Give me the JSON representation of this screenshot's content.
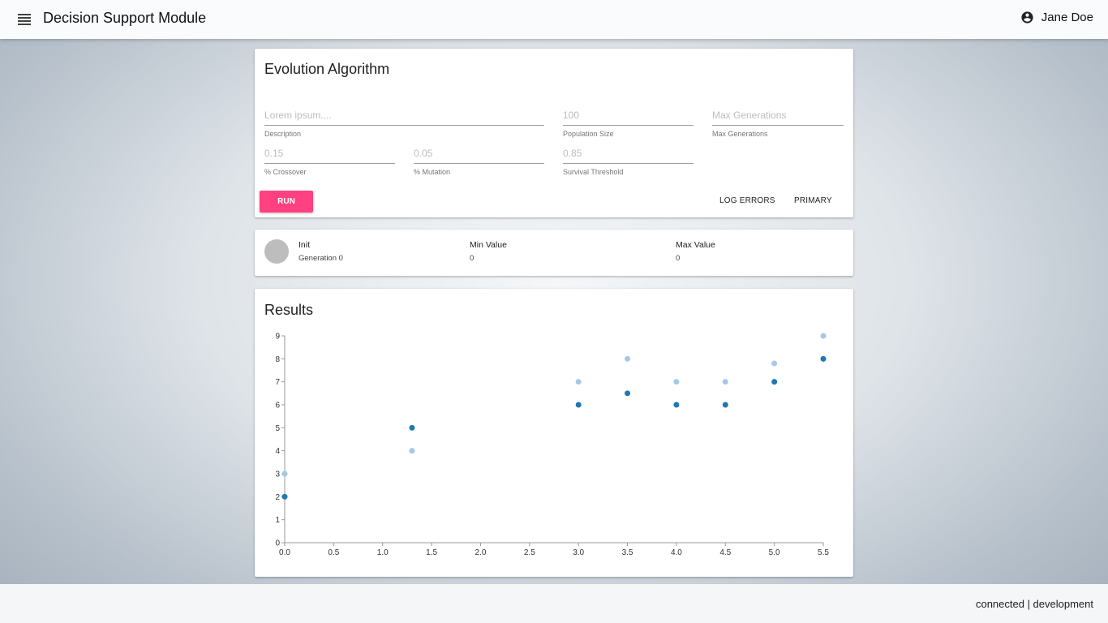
{
  "topbar": {
    "title": "Decision Support Module",
    "user_name": "Jane Doe"
  },
  "form_card": {
    "title": "Evolution Algorithm",
    "fields": {
      "description": {
        "placeholder": "Lorem ipsum....",
        "label": "Description"
      },
      "population_size": {
        "placeholder": "100",
        "label": "Population Size"
      },
      "max_generations": {
        "placeholder": "Max Generations",
        "label": "Max Generations"
      },
      "crossover": {
        "placeholder": "0.15",
        "label": "% Crossover"
      },
      "mutation": {
        "placeholder": "0.05",
        "label": "% Mutation"
      },
      "survival_threshold": {
        "placeholder": "0.85",
        "label": "Survival Threshold"
      }
    },
    "buttons": {
      "run": "RUN",
      "log_errors": "LOG ERRORS",
      "primary": "PRIMARY"
    }
  },
  "status_card": {
    "state": "Init",
    "generation": "Generation 0",
    "min_label": "Min Value",
    "min_value": "0",
    "max_label": "Max Value",
    "max_value": "0"
  },
  "results_card": {
    "title": "Results"
  },
  "chart_data": {
    "type": "scatter",
    "xlim": [
      0,
      5.5
    ],
    "ylim": [
      0,
      9
    ],
    "x_ticks": [
      "0.0",
      "0.5",
      "1.0",
      "1.5",
      "2.0",
      "2.5",
      "3.0",
      "3.5",
      "4.0",
      "4.5",
      "5.0",
      "5.5"
    ],
    "y_ticks": [
      "0",
      "1",
      "2",
      "3",
      "4",
      "5",
      "6",
      "7",
      "8",
      "9"
    ],
    "series": [
      {
        "color": "#a6c8e8",
        "points": [
          [
            0.0,
            3
          ],
          [
            1.3,
            4
          ],
          [
            3.0,
            7
          ],
          [
            3.5,
            8
          ],
          [
            4.0,
            7
          ],
          [
            4.5,
            7
          ],
          [
            5.0,
            7.8
          ],
          [
            5.5,
            9
          ]
        ]
      },
      {
        "color": "#1f77b4",
        "points": [
          [
            0.0,
            2
          ],
          [
            1.3,
            5
          ],
          [
            3.0,
            6
          ],
          [
            3.5,
            6.5
          ],
          [
            4.0,
            6
          ],
          [
            4.5,
            6
          ],
          [
            5.0,
            7
          ],
          [
            5.5,
            8
          ]
        ]
      }
    ]
  },
  "footer": {
    "status": "connected | development"
  }
}
